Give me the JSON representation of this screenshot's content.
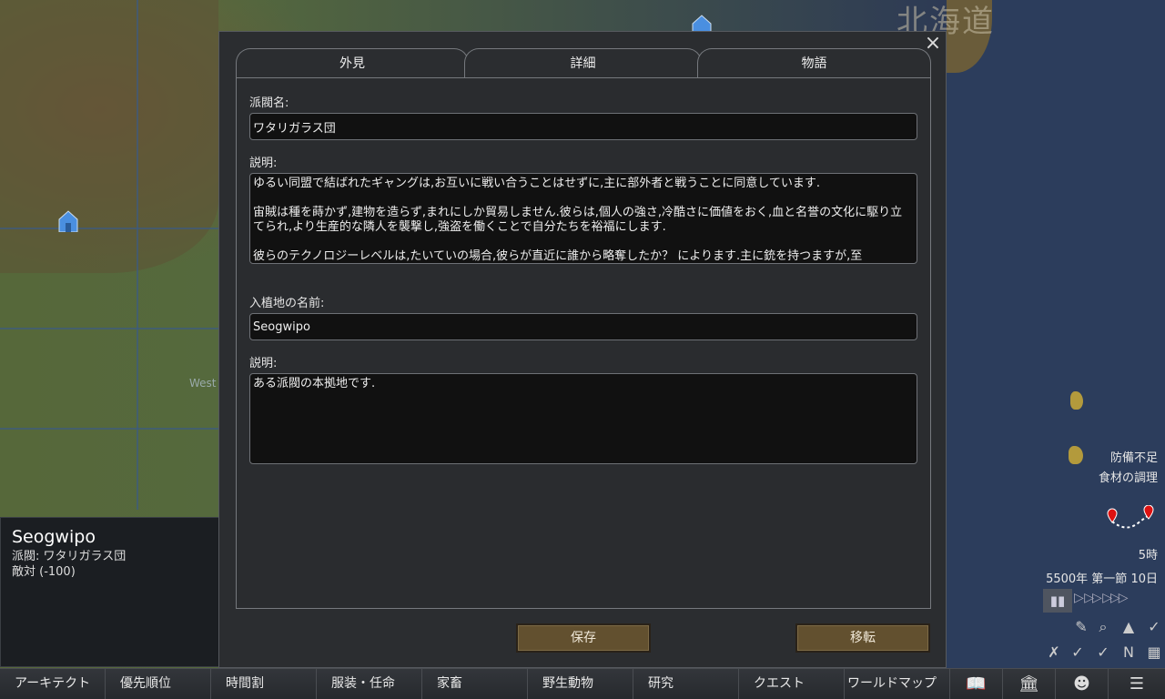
{
  "map": {
    "label_hokkaido": "北海道",
    "label_west": "West"
  },
  "info_panel": {
    "title": "Seogwipo",
    "faction_line": "派閥: ワタリガラス団",
    "relation_line": "敵対 (-100)"
  },
  "dialog": {
    "close_icon": "×",
    "tabs": [
      {
        "label": "外見"
      },
      {
        "label": "詳細"
      },
      {
        "label": "物語"
      }
    ],
    "faction_name_label": "派閥名:",
    "faction_name_value": "ワタリガラス団",
    "faction_desc_label": "説明:",
    "faction_desc_value": "ゆるい同盟で結ばれたギャングは,お互いに戦い合うことはせずに,主に部外者と戦うことに同意しています.\n\n宙賊は種を蒔かず,建物を造らず,まれにしか貿易しません.彼らは,個人の強さ,冷酷さに価値をおく,血と名誉の文化に駆り立てられ,より生産的な隣人を襲撃し,強盗を働くことで自分たちを裕福にします.\n\n彼らのテクノロジーレベルは,たいていの場合,彼らが直近に誰から略奪したか？ によります.主に銃を持つますが,至",
    "settlement_name_label": "入植地の名前:",
    "settlement_name_value": "Seogwipo",
    "settlement_desc_label": "説明:",
    "settlement_desc_value": "ある派閥の本拠地です.",
    "save_button": "保存",
    "move_button": "移転"
  },
  "hud": {
    "alert1": "防備不足",
    "alert2": "食材の調理",
    "time": "5時",
    "date": "5500年 第一節 10日",
    "pause_icon": "pause-icon",
    "speed_arrows": "▷ ▷▷ ▷▷▷"
  },
  "bottom_bar": {
    "tabs": [
      {
        "label": "アーキテクト"
      },
      {
        "label": "優先順位"
      },
      {
        "label": "時間割"
      },
      {
        "label": "服装・任命"
      },
      {
        "label": "家畜"
      },
      {
        "label": "野生動物"
      },
      {
        "label": "研究"
      },
      {
        "label": "クエスト"
      },
      {
        "label": "ワールドマップ"
      }
    ],
    "icons": [
      "book-icon",
      "factions-icon",
      "colonist-portrait-icon",
      "menu-icon"
    ]
  },
  "colors": {
    "button_brown": "#62502f",
    "dialog_bg": "#2b2d30",
    "input_bg": "#111111"
  }
}
